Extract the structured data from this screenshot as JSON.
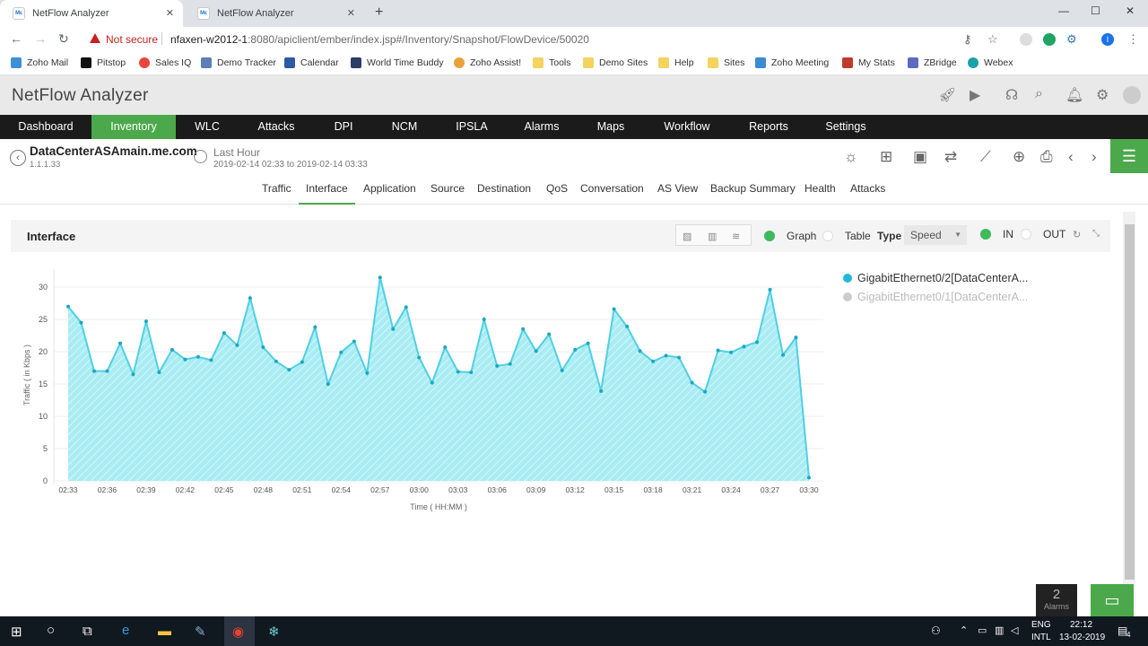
{
  "browser": {
    "tabs": [
      {
        "label": "NetFlow Analyzer",
        "favicon": "Mε"
      },
      {
        "label": "NetFlow Analyzer",
        "favicon": "Mε"
      }
    ],
    "not_secure": "Not secure",
    "url_host": "nfaxen-w2012-1",
    "url_rest": ":8080/apiclient/ember/index.jsp#/Inventory/Snapshot/FlowDevice/50020",
    "bookmarks": [
      "Zoho Mail",
      "Pitstop",
      "Sales IQ",
      "Demo Tracker",
      "Calendar",
      "World Time Buddy",
      "Zoho Assist!",
      "Tools",
      "Demo Sites",
      "Help",
      "Sites",
      "Zoho Meeting",
      "My Stats",
      "ZBridge",
      "Webex"
    ],
    "profile_initial": "I"
  },
  "app": {
    "title": "NetFlow Analyzer",
    "nav": [
      "Dashboard",
      "Inventory",
      "WLC",
      "Attacks",
      "DPI",
      "NCM",
      "IPSLA",
      "Alarms",
      "Maps",
      "Workflow",
      "Reports",
      "Settings"
    ],
    "active_nav": "Inventory"
  },
  "device": {
    "name": "DataCenterASAmain.me.com",
    "ip": "1.1.1.33",
    "period": "Last Hour",
    "range": "2019-02-14 02:33 to 2019-02-14 03:33"
  },
  "subtabs": [
    "Traffic",
    "Interface",
    "Application",
    "Source",
    "Destination",
    "QoS",
    "Conversation",
    "AS View",
    "Backup Summary",
    "Health",
    "Attacks"
  ],
  "active_subtab": "Interface",
  "panel": {
    "title": "Interface",
    "graph_label": "Graph",
    "table_label": "Table",
    "type_label": "Type",
    "type_value": "Speed",
    "in_label": "IN",
    "out_label": "OUT"
  },
  "chart_data": {
    "type": "area",
    "xlabel": "Time ( HH:MM )",
    "ylabel": "Traffic ( in Kbps )",
    "ylim": [
      0,
      32
    ],
    "yticks": [
      0,
      5,
      10,
      15,
      20,
      25,
      30
    ],
    "xtick_labels": [
      "02:33",
      "02:36",
      "02:39",
      "02:42",
      "02:45",
      "02:48",
      "02:51",
      "02:54",
      "02:57",
      "03:00",
      "03:03",
      "03:06",
      "03:09",
      "03:12",
      "03:15",
      "03:18",
      "03:21",
      "03:24",
      "03:27",
      "03:30"
    ],
    "color": "#4fd0e4",
    "series": [
      {
        "name": "GigabitEthernet0/2[DataCenterA...",
        "x_minutes": [
          0,
          1,
          2,
          3,
          4,
          5,
          6,
          7,
          8,
          9,
          10,
          11,
          12,
          13,
          14,
          15,
          16,
          17,
          18,
          19,
          20,
          21,
          22,
          23,
          24,
          25,
          26,
          27,
          28,
          29,
          30,
          31,
          32,
          33,
          34,
          35,
          36,
          37,
          38,
          39,
          40,
          41,
          42,
          43,
          44,
          45,
          46,
          47,
          48,
          49,
          50,
          51,
          52,
          53,
          54,
          55,
          56,
          57
        ],
        "values": [
          27,
          24.5,
          17,
          17,
          21.3,
          16.5,
          24.7,
          16.8,
          20.3,
          18.8,
          19.2,
          18.7,
          22.9,
          21,
          28.3,
          20.7,
          18.5,
          17.2,
          18.4,
          23.8,
          15,
          19.9,
          21.6,
          16.7,
          31.5,
          23.5,
          26.9,
          19.1,
          15.2,
          20.7,
          16.9,
          16.8,
          25,
          17.8,
          18.1,
          23.5,
          20.1,
          22.7,
          17.1,
          20.3,
          21.3,
          13.9,
          26.6,
          23.9,
          20.1,
          18.5,
          19.4,
          19.1,
          15.2,
          13.8,
          20.2,
          19.9,
          20.8,
          21.5,
          29.6,
          19.5,
          22.2,
          0.5
        ]
      },
      {
        "name": "GigabitEthernet0/1[DataCenterA...",
        "values": []
      }
    ],
    "legend_colors": [
      "#22b8d8",
      "#cccccc"
    ]
  },
  "alarms": {
    "count": "2",
    "label": "Alarms"
  },
  "taskbar": {
    "lang1": "ENG",
    "lang2": "INTL",
    "time": "22:12",
    "date": "13-02-2019",
    "notifications": "4"
  }
}
